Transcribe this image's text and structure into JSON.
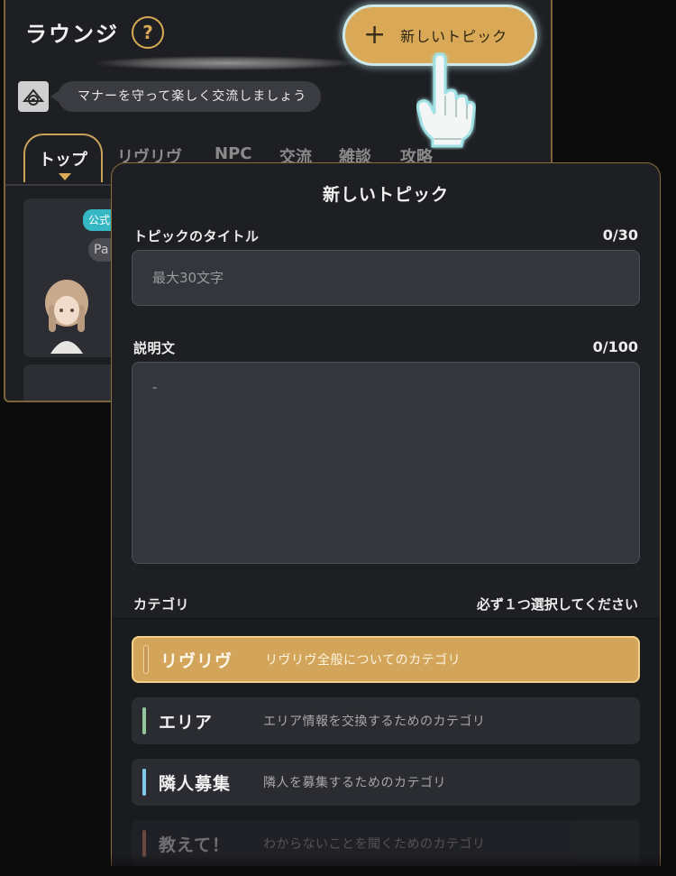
{
  "lounge": {
    "title": "ラウンジ",
    "help_symbol": "?",
    "manner_message": "マナーを守って楽しく交流しましょう",
    "tabs": [
      {
        "label": "トップ",
        "active": true
      },
      {
        "label": "リヴリヴ",
        "active": false
      },
      {
        "label": "NPC",
        "active": false
      },
      {
        "label": "交流",
        "active": false
      },
      {
        "label": "雑談",
        "active": false
      },
      {
        "label": "攻略",
        "active": false
      }
    ],
    "card": {
      "badge": "公式",
      "tag": "Pa"
    }
  },
  "new_topic_button": {
    "plus": "+",
    "label": "新しいトピック"
  },
  "modal": {
    "title": "新しいトピック",
    "topic_title": {
      "label": "トピックのタイトル",
      "count": "0/30",
      "placeholder": "最大30文字",
      "value": ""
    },
    "description": {
      "label": "説明文",
      "count": "0/100",
      "placeholder": "-",
      "value": ""
    },
    "category": {
      "label": "カテゴリ",
      "hint": "必ず１つ選択してください",
      "items": [
        {
          "name": "リヴリヴ",
          "description": "リヴリヴ全般についてのカテゴリ",
          "color": "#c8955a",
          "selected": true
        },
        {
          "name": "エリア",
          "description": "エリア情報を交換するためのカテゴリ",
          "color": "#8fc79a",
          "selected": false
        },
        {
          "name": "隣人募集",
          "description": "隣人を募集するためのカテゴリ",
          "color": "#7fc9e6",
          "selected": false
        },
        {
          "name": "教えて！",
          "description": "わからないことを聞くためのカテゴリ",
          "color": "#e08a7a",
          "selected": false
        }
      ]
    }
  },
  "colors": {
    "accent": "#d9a957",
    "panel": "#1e1f23",
    "input": "#33363c"
  }
}
